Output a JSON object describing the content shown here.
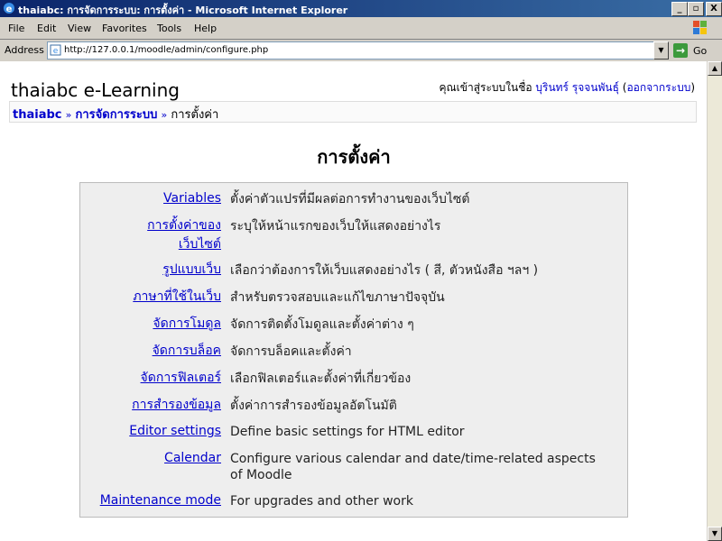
{
  "window": {
    "title": "thaiabc: การจัดการระบบ: การตั้งค่า - Microsoft Internet Explorer",
    "minimize": "_",
    "maximize": "▫",
    "close": "X"
  },
  "menu": [
    "File",
    "Edit",
    "View",
    "Favorites",
    "Tools",
    "Help"
  ],
  "address": {
    "label": "Address",
    "url": "http://127.0.0.1/moodle/admin/configure.php",
    "go_label": "Go"
  },
  "header": {
    "site_name": "thaiabc e-Learning",
    "login_prefix": "คุณเข้าสู่ระบบในชื่อ ",
    "user_name": "บุรินทร์ รุจจนพันธุ์",
    "logout_open": " (",
    "logout_label": "ออกจากระบบ",
    "logout_close": ")"
  },
  "breadcrumb": {
    "home": "thaiabc",
    "sep": "»",
    "admin": "การจัดการระบบ",
    "current": "การตั้งค่า"
  },
  "page_title": "การตั้งค่า",
  "settings": [
    {
      "link": "Variables",
      "desc": "ตั้งค่าตัวแปรที่มีผลต่อการทำงานของเว็บไซต์"
    },
    {
      "link": "การตั้งค่าของเว็บไซต์",
      "desc": "ระบุให้หน้าแรกของเว็บให้แสดงอย่างไร"
    },
    {
      "link": "รูปแบบเว็บ",
      "desc": "เลือกว่าต้องการให้เว็บแสดงอย่างไร ( สี, ตัวหนังสือ ฯลฯ )"
    },
    {
      "link": "ภาษาที่ใช้ในเว็บ",
      "desc": "สำหรับตรวจสอบและแก้ไขภาษาปัจจุบัน"
    },
    {
      "link": "จัดการโมดูล",
      "desc": "จัดการติดตั้งโมดูลและตั้งค่าต่าง ๆ"
    },
    {
      "link": "จัดการบล็อค",
      "desc": "จัดการบล็อคและตั้งค่า"
    },
    {
      "link": "จัดการฟิลเตอร์",
      "desc": "เลือกฟิลเตอร์และตั้งค่าที่เกี่ยวข้อง"
    },
    {
      "link": "การสำรองข้อมูล",
      "desc": "ตั้งค่าการสำรองข้อมูลอัตโนมัติ"
    },
    {
      "link": "Editor settings",
      "desc": "Define basic settings for HTML editor"
    },
    {
      "link": "Calendar",
      "desc": "Configure various calendar and date/time-related aspects of Moodle"
    },
    {
      "link": "Maintenance mode",
      "desc": "For upgrades and other work"
    }
  ],
  "colors": {
    "link": "#0000cc",
    "box_bg": "#eeeeee",
    "title_bar": "#0a246a"
  }
}
